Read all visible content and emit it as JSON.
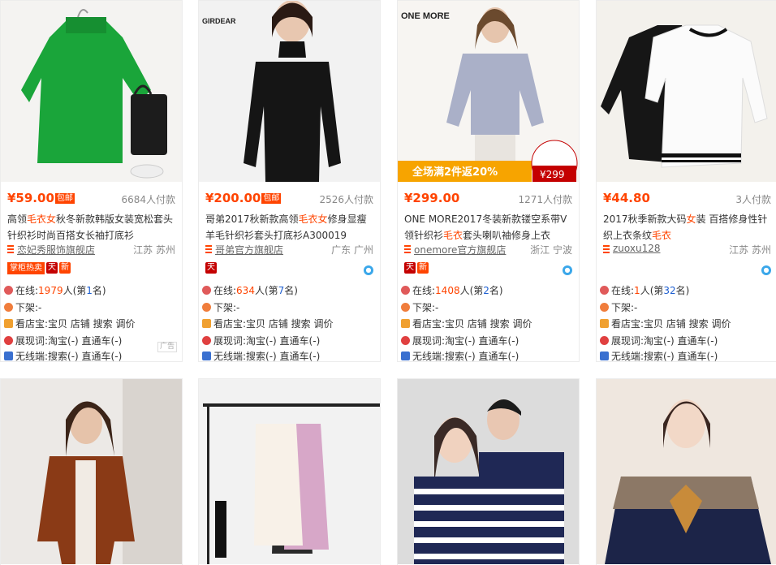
{
  "products": [
    {
      "price": "¥59.00",
      "baoyou": "包邮",
      "sales": "6684人付款",
      "title_parts": [
        "高领",
        "毛衣女",
        "秋冬新款韩版女装宽松套头针织衫时尚百搭女长袖打底衫"
      ],
      "shop": "恋妃秀服饰旗舰店",
      "location": "江苏 苏州",
      "badge_text": "掌柜热卖",
      "badge_tmall": "天",
      "badge_new": "新",
      "online_label": "在线:",
      "online_count": "1979",
      "online_rank_prefix": "人(第",
      "online_rank": "1",
      "online_rank_suffix": "名)",
      "offline": "下架:-",
      "store_tools": "看店宝:宝贝 店铺 搜索 调价",
      "exposure": "展现词:淘宝(-) 直通车(-)",
      "wireless": "无线端:搜索(-) 直通车(-)",
      "ad": "广告",
      "image_brand": ""
    },
    {
      "price": "¥200.00",
      "baoyou": "包邮",
      "sales": "2526人付款",
      "title_parts": [
        "哥弟2017秋新款高领",
        "毛衣女",
        "修身显瘦羊毛针织衫套头打底衫A300019"
      ],
      "shop": "哥弟官方旗舰店",
      "location": "广东 广州",
      "badge_text": "",
      "badge_tmall": "天",
      "badge_new": "",
      "online_label": "在线:",
      "online_count": "634",
      "online_rank_prefix": "人(第",
      "online_rank": "7",
      "online_rank_suffix": "名)",
      "offline": "下架:-",
      "store_tools": "看店宝:宝贝 店铺 搜索 调价",
      "exposure": "展现词:淘宝(-) 直通车(-)",
      "wireless": "无线端:搜索(-) 直通车(-)",
      "ad": "",
      "image_brand": "GIRDEAR"
    },
    {
      "price": "¥299.00",
      "baoyou": "",
      "sales": "1271人付款",
      "title_parts": [
        "ONE MORE2017冬装新款镂空系带V领针织衫",
        "毛衣",
        "套头喇叭袖修身上衣"
      ],
      "shop": "onemore官方旗舰店",
      "location": "浙江 宁波",
      "badge_text": "",
      "badge_tmall": "天",
      "badge_new": "新",
      "online_label": "在线:",
      "online_count": "1408",
      "online_rank_prefix": "人(第",
      "online_rank": "2",
      "online_rank_suffix": "名)",
      "offline": "下架:-",
      "store_tools": "看店宝:宝贝 店铺 搜索 调价",
      "exposure": "展现词:淘宝(-) 直通车(-)",
      "wireless": "无线端:搜索(-) 直通车(-)",
      "ad": "",
      "image_brand": "ONE MORE",
      "image_promo": "全场满2件返20%",
      "image_price": "¥299"
    },
    {
      "price": "¥44.80",
      "baoyou": "",
      "sales": "3人付款",
      "title_parts": [
        "2017秋季新款大码",
        "女",
        "装 百搭修身性针织上衣条纹",
        "毛衣"
      ],
      "shop": "zuoxu128",
      "location": "江苏 苏州",
      "badge_text": "",
      "badge_tmall": "",
      "badge_new": "",
      "online_label": "在线:",
      "online_count": "1",
      "online_rank_prefix": "人(第",
      "online_rank": "32",
      "online_rank_suffix": "名)",
      "offline": "下架:-",
      "store_tools": "看店宝:宝贝 店铺 搜索 调价",
      "exposure": "展现词:淘宝(-) 直通车(-)",
      "wireless": "无线端:搜索(-) 直通车(-)",
      "ad": "",
      "image_brand": ""
    }
  ],
  "colors": {
    "accent": "#ff4400",
    "rank_blue": "#1d5ed0",
    "tmall_red": "#c40000",
    "wangwang_blue": "#3aa7ea"
  }
}
